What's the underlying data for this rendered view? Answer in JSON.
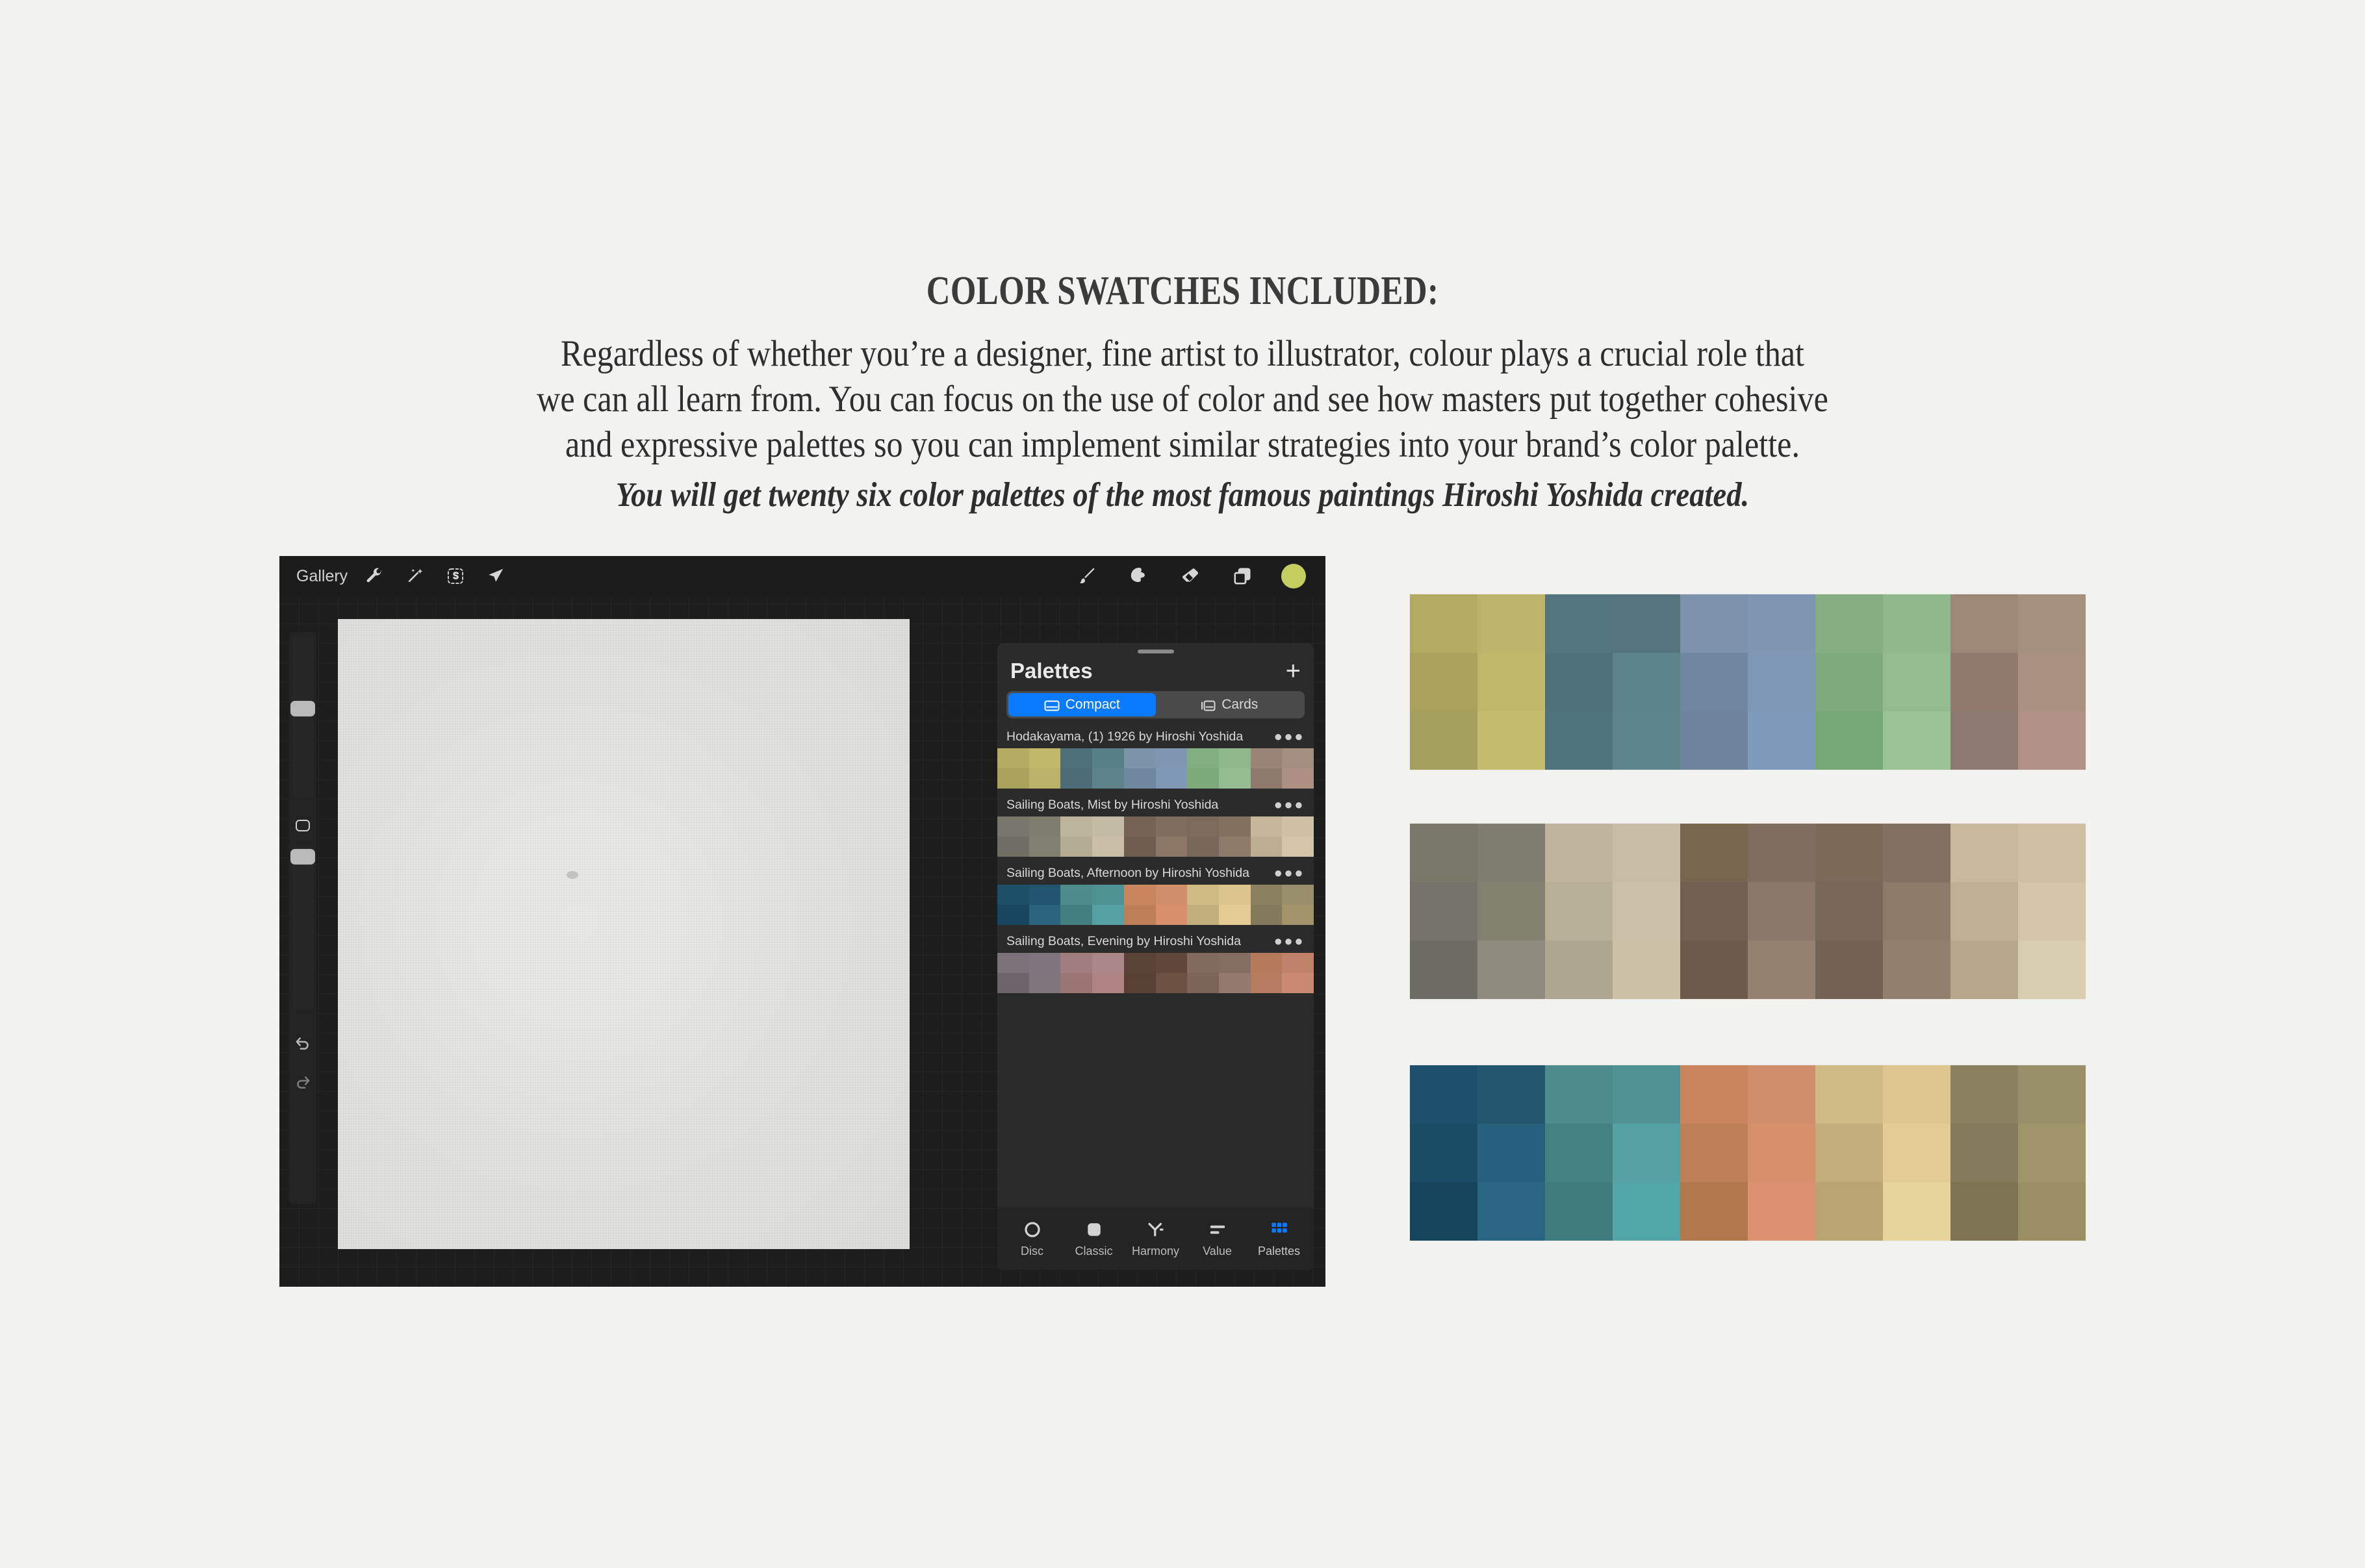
{
  "heading": {
    "title": "COLOR SWATCHES INCLUDED:",
    "paragraph_line1": "Regardless of whether you’re a designer, fine artist to illustrator, colour plays a crucial role that",
    "paragraph_line2": "we can all learn from. You can focus on the use of color and see how masters put together cohesive",
    "paragraph_line3": "and expressive palettes so you can implement similar strategies into your brand’s color palette.",
    "emphasis": "You will get twenty six color palettes of the most famous paintings Hiroshi Yoshida created."
  },
  "app": {
    "toolbar": {
      "gallery_label": "Gallery",
      "left_icons": [
        "wrench-icon",
        "magic-wand-icon",
        "selection-s-icon",
        "transform-arrow-icon"
      ],
      "right_icons": [
        "paintbrush-icon",
        "smudge-icon",
        "eraser-icon",
        "layers-icon"
      ],
      "active_color": "#c3ce5e"
    },
    "sidebar": {
      "brush_size_label": "brush-size-slider",
      "opacity_label": "opacity-slider",
      "modify_label": "modify-button",
      "undo_label": "undo-button",
      "redo_label": "redo-button"
    },
    "panel": {
      "title": "Palettes",
      "add_label": "+",
      "view_modes": [
        {
          "label": "Compact",
          "icon": "compact-view-icon",
          "active": true
        },
        {
          "label": "Cards",
          "icon": "cards-view-icon",
          "active": false
        }
      ],
      "accent_color": "#0a7bff",
      "menu_glyph": "●●●",
      "palettes": [
        {
          "name": "Hodakayama, (1) 1926 by Hiroshi Yoshida",
          "rows": [
            [
              "#b4ac60",
              "#bfb869",
              "#4e7079",
              "#577f86",
              "#7b94aa",
              "#7e96b2",
              "#83ae81",
              "#8fb98c",
              "#9b8375",
              "#a48e80"
            ],
            [
              "#aaa25c",
              "#bbb468",
              "#4b6c76",
              "#5d8289",
              "#6f88a0",
              "#7e98b5",
              "#7daa7b",
              "#95bd92",
              "#8e7a6c",
              "#ad9083"
            ]
          ]
        },
        {
          "name": "Sailing Boats, Mist by Hiroshi Yoshida",
          "rows": [
            [
              "#78766a",
              "#7e7c6d",
              "#bdb49c",
              "#c3bba3",
              "#756253",
              "#806d5e",
              "#7d6a5a",
              "#83705f",
              "#c6b79a",
              "#cec0a4"
            ],
            [
              "#706e62",
              "#817f70",
              "#b5ac94",
              "#c8bfa6",
              "#6f5d4f",
              "#8c7767",
              "#78685b",
              "#8d7a68",
              "#bcae92",
              "#d3c5a9"
            ]
          ]
        },
        {
          "name": "Sailing Boats, Afternoon by Hiroshi Yoshida",
          "rows": [
            [
              "#1d4f69",
              "#225670",
              "#4d8c8a",
              "#4f9296",
              "#c9855d",
              "#d08f6a",
              "#cfba84",
              "#dcc48e",
              "#8b8161",
              "#9a8f6c"
            ],
            [
              "#17465e",
              "#2a6280",
              "#437f7f",
              "#55a0a2",
              "#bd7f57",
              "#d8906c",
              "#c2ae7b",
              "#e3cb93",
              "#837a5c",
              "#a09468"
            ]
          ]
        },
        {
          "name": "Sailing Boats, Evening by Hiroshi Yoshida",
          "rows": [
            [
              "#7b7178",
              "#7f757f",
              "#a17e7d",
              "#ab8686",
              "#5a4236",
              "#61463a",
              "#836a5f",
              "#866d62",
              "#b6795c",
              "#c08268"
            ],
            [
              "#6d646a",
              "#7e747c",
              "#9b7573",
              "#b08383",
              "#584035",
              "#6d5143",
              "#7d645b",
              "#93796f",
              "#b67c60",
              "#ca8a71"
            ]
          ]
        }
      ]
    },
    "tabbar": [
      {
        "label": "Disc",
        "icon": "disc-icon",
        "active": false
      },
      {
        "label": "Classic",
        "icon": "classic-icon",
        "active": false
      },
      {
        "label": "Harmony",
        "icon": "harmony-icon",
        "active": false
      },
      {
        "label": "Value",
        "icon": "value-icon",
        "active": false
      },
      {
        "label": "Palettes",
        "icon": "palettes-grid-icon",
        "active": true
      }
    ]
  },
  "swatch_boards": [
    {
      "name": "Hodakayama, (1) 1926 by Hiroshi Yoshida",
      "rows": [
        [
          "#b3ab61",
          "#bcb569",
          "#52757e",
          "#54757d",
          "#7c93ab",
          "#7f96b2",
          "#85ae83",
          "#8fb88d",
          "#9d8878",
          "#a6907f"
        ],
        [
          "#aaa25c",
          "#bfb86b",
          "#4e717a",
          "#5c828a",
          "#70889f",
          "#7d97b4",
          "#7faa7d",
          "#92bb8f",
          "#91796c",
          "#a9907f"
        ],
        [
          "#a4a05c",
          "#c3bb6d",
          "#4f747d",
          "#5f858c",
          "#6d849c",
          "#7e9abb",
          "#76a876",
          "#9bc297",
          "#8a7a70",
          "#b19185"
        ]
      ]
    },
    {
      "name": "Sailing Boats, Mist by Hiroshi Yoshida",
      "rows": [
        [
          "#7a7869",
          "#7f7d6e",
          "#bdb49b",
          "#c6bda4",
          "#79664f",
          "#7f6d5d",
          "#7c6a59",
          "#827060",
          "#c8b99c",
          "#cfc0a5"
        ],
        [
          "#74726a",
          "#838170",
          "#b8af97",
          "#c9c0a7",
          "#70604f",
          "#8c7868",
          "#786859",
          "#8c7a69",
          "#bfb093",
          "#d2c5a9"
        ],
        [
          "#6d6c62",
          "#8e8a7d",
          "#aea68e",
          "#cbc1a6",
          "#6c5b4a",
          "#93806f",
          "#726253",
          "#91806d",
          "#b5a88b",
          "#d9cdb0"
        ]
      ]
    },
    {
      "name": "Sailing Boats, Afternoon by Hiroshi Yoshida",
      "rows": [
        [
          "#1d506a",
          "#235770",
          "#4d8c8a",
          "#509295",
          "#c9855c",
          "#d08e6b",
          "#cfb985",
          "#dcc58f",
          "#8b8160",
          "#9a8f6b"
        ],
        [
          "#1b4c66",
          "#27607e",
          "#438080",
          "#56a1a3",
          "#bd7f57",
          "#d7906c",
          "#c2ad7b",
          "#e3cb94",
          "#837b5b",
          "#a09568"
        ],
        [
          "#16445b",
          "#2a6584",
          "#3f7b7c",
          "#52a5a7",
          "#b3774d",
          "#dc9170",
          "#b9a472",
          "#e7d39c",
          "#7d7453",
          "#9a8e63"
        ]
      ]
    }
  ]
}
